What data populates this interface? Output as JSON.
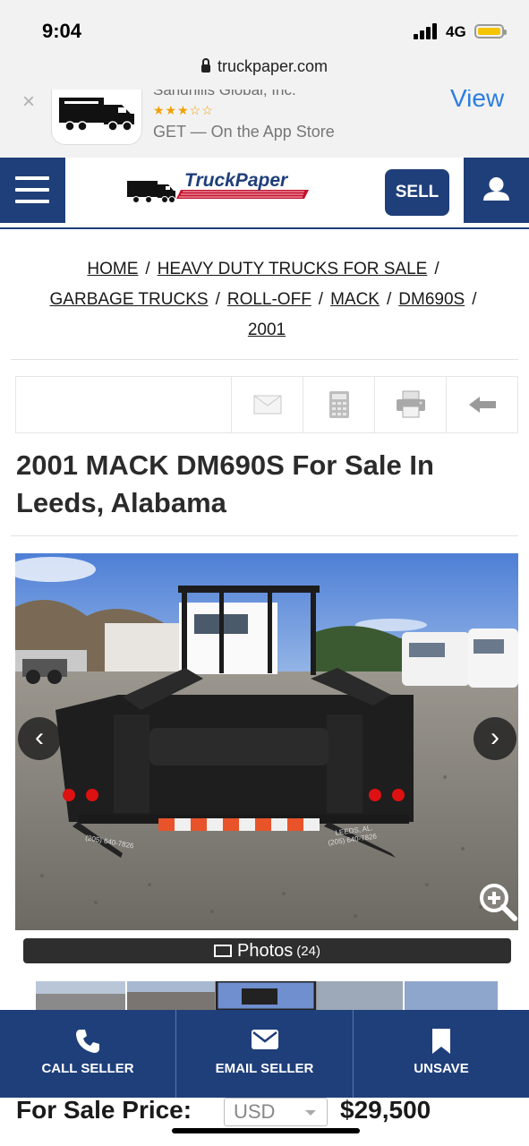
{
  "status_bar": {
    "time": "9:04",
    "network": "4G"
  },
  "browser": {
    "url": "truckpaper.com"
  },
  "app_banner": {
    "developer": "Sandhills Global, Inc.",
    "rating_stars": "★★★☆☆",
    "get_text": "GET — On the App Store",
    "view_label": "View",
    "close_glyph": "×"
  },
  "header": {
    "logo_text": "TruckPaper",
    "sell_label": "SELL"
  },
  "breadcrumb": [
    "HOME",
    "HEAVY DUTY TRUCKS FOR SALE",
    "GARBAGE TRUCKS",
    "ROLL-OFF",
    "MACK",
    "DM690S",
    "2001"
  ],
  "toolbar": {
    "icons": [
      "email-icon",
      "calculator-icon",
      "print-icon",
      "back-arrow-icon"
    ]
  },
  "listing": {
    "title": "2001 MACK DM690S For Sale In Leeds, Alabama"
  },
  "gallery": {
    "photos_label": "Photos",
    "photo_count": "(24)",
    "prev_glyph": "‹",
    "next_glyph": "›",
    "decal_left": "(205) 640-7826",
    "decal_right_1": "LEEDS, AL.",
    "decal_right_2": "(205) 640-7826"
  },
  "actions": {
    "call_label": "CALL SELLER",
    "email_label": "EMAIL SELLER",
    "unsave_label": "UNSAVE"
  },
  "price": {
    "label": "For Sale Price:",
    "currency": "USD",
    "amount": "$29,500"
  },
  "colors": {
    "brand_navy": "#1f3f7a",
    "brand_red": "#c8102e",
    "ios_link_blue": "#2b7de0",
    "battery": "#f5c400"
  }
}
